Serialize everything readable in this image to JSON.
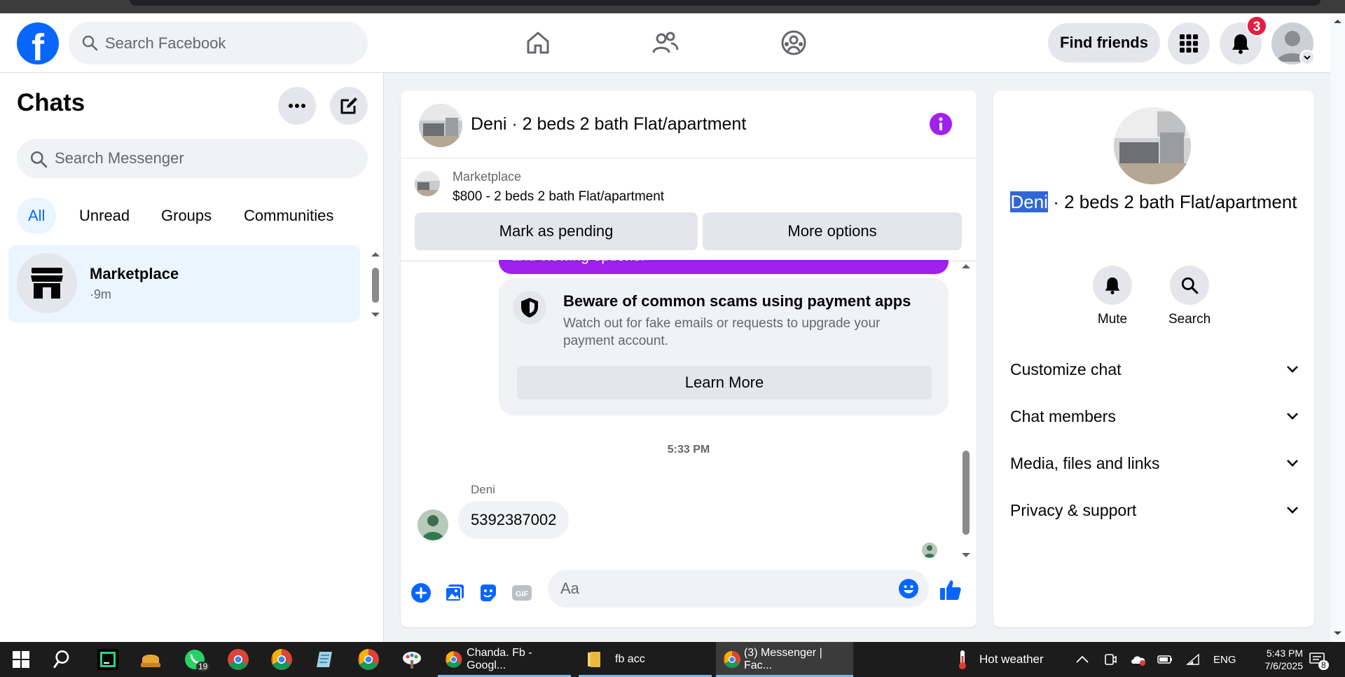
{
  "header": {
    "search_placeholder": "Search Facebook",
    "find_friends": "Find friends",
    "notification_count": "3"
  },
  "left": {
    "title": "Chats",
    "search_placeholder": "Search Messenger",
    "filters": [
      "All",
      "Unread",
      "Groups",
      "Communities"
    ],
    "chat": {
      "name": "Marketplace",
      "time": "·9m"
    }
  },
  "conversation": {
    "title": "Deni · 2 beds 2 bath Flat/apartment",
    "marketplace": {
      "label": "Marketplace",
      "price_line": "$800 - 2 beds 2 bath Flat/apartment",
      "mark_pending": "Mark as pending",
      "more_options": "More options"
    },
    "purple_text": "and viewing options.",
    "scam": {
      "title": "Beware of common scams using payment apps",
      "body": "Watch out for fake emails or requests to upgrade your payment account.",
      "button": "Learn More"
    },
    "timestamp": "5:33 PM",
    "sender": "Deni",
    "message": "5392387002",
    "input_placeholder": "Aa"
  },
  "right_panel": {
    "title_highlight": "Deni",
    "title_rest": " · 2 beds 2 bath Flat/apartment",
    "mute": "Mute",
    "search": "Search",
    "sections": [
      "Customize chat",
      "Chat members",
      "Media, files and links",
      "Privacy & support"
    ]
  },
  "taskbar": {
    "whatsapp_badge": "19",
    "apps": [
      {
        "label": "Chanda. Fb - Googl..."
      },
      {
        "label": "fb acc"
      },
      {
        "label": "(3) Messenger | Fac..."
      }
    ],
    "weather": "Hot weather",
    "lang": "ENG",
    "time": "5:43 PM",
    "date": "7/6/2025",
    "notif_count": "8"
  },
  "colors": {
    "brand": "#0866ff",
    "accent": "#a020f0",
    "badge": "#e41e3f"
  }
}
